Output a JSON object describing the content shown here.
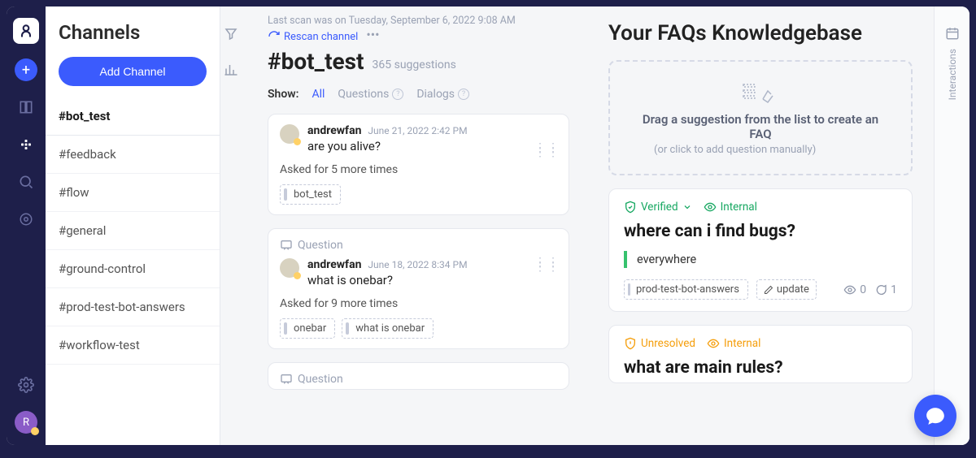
{
  "rail": {
    "avatar_initial": "R"
  },
  "sidebar": {
    "title": "Channels",
    "add_button": "Add Channel",
    "items": [
      {
        "label": "#bot_test",
        "active": true
      },
      {
        "label": "#feedback"
      },
      {
        "label": "#flow"
      },
      {
        "label": "#general"
      },
      {
        "label": "#ground-control"
      },
      {
        "label": "#prod-test-bot-answers"
      },
      {
        "label": "#workflow-test"
      }
    ]
  },
  "suggestions": {
    "scan_line": "Last scan was on Tuesday, September 6, 2022 9:08 AM",
    "rescan_label": "Rescan channel",
    "title": "#bot_test",
    "count": "365 suggestions",
    "show_label": "Show:",
    "filters": {
      "all": "All",
      "questions": "Questions",
      "dialogs": "Dialogs"
    },
    "cards": [
      {
        "user": "andrewfan",
        "date": "June 21, 2022 2:42 PM",
        "text": "are you alive?",
        "asked": "Asked for 5 more times",
        "tags": [
          "bot_test"
        ]
      },
      {
        "header": "Question",
        "user": "andrewfan",
        "date": "June 18, 2022 8:34 PM",
        "text": "what is onebar?",
        "asked": "Asked for 9 more times",
        "tags": [
          "onebar",
          "what is onebar"
        ]
      },
      {
        "header": "Question"
      }
    ]
  },
  "kb": {
    "title": "Your FAQs Knowledgebase",
    "drop_main": "Drag a suggestion from the list to create an FAQ",
    "drop_sub": "(or click to add question manually)",
    "faqs": [
      {
        "status": "Verified",
        "scope": "Internal",
        "question": "where can i find bugs?",
        "answer": "everywhere",
        "pill": "prod-test-bot-answers",
        "update": "update",
        "views": "0",
        "comments": "1"
      },
      {
        "status": "Unresolved",
        "scope": "Internal",
        "question": "what are main rules?"
      }
    ]
  },
  "right_rail": {
    "label": "Interactions"
  }
}
